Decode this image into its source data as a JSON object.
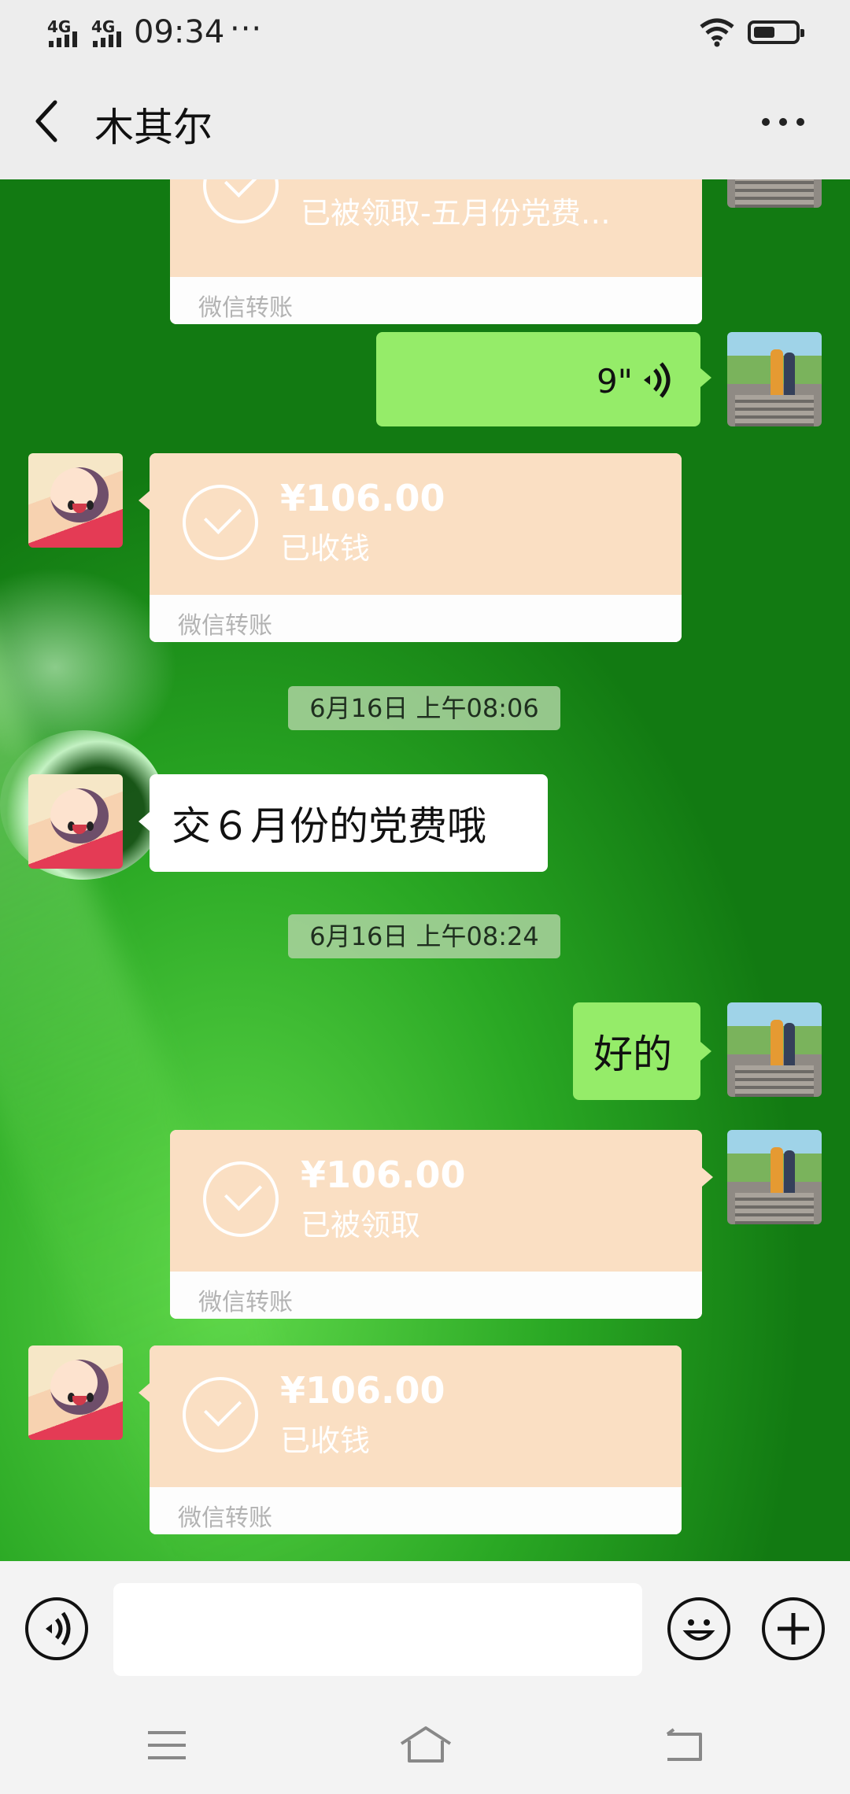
{
  "status_bar": {
    "signal1": "4G",
    "signal2": "4G",
    "time": "09:34",
    "more": "···"
  },
  "header": {
    "title": "木其尔"
  },
  "messages": {
    "t0": {
      "status": "已被领取-五月份党费…",
      "brand": "微信转账"
    },
    "voice": {
      "duration": "9\""
    },
    "t1": {
      "amount": "¥106.00",
      "status": "已收钱",
      "brand": "微信转账"
    },
    "time1": "6月16日 上午08:06",
    "text1": "交６月份的党费哦",
    "time2": "6月16日 上午08:24",
    "text2": "好的",
    "t2": {
      "amount": "¥106.00",
      "status": "已被领取",
      "brand": "微信转账"
    },
    "t3": {
      "amount": "¥106.00",
      "status": "已收钱",
      "brand": "微信转账"
    }
  },
  "input": {
    "placeholder": ""
  },
  "colors": {
    "header_bg": "#ededed",
    "transfer_bg": "#fadfc3",
    "sent_bubble": "#95ec69",
    "chat_bg": "#2aa824"
  }
}
